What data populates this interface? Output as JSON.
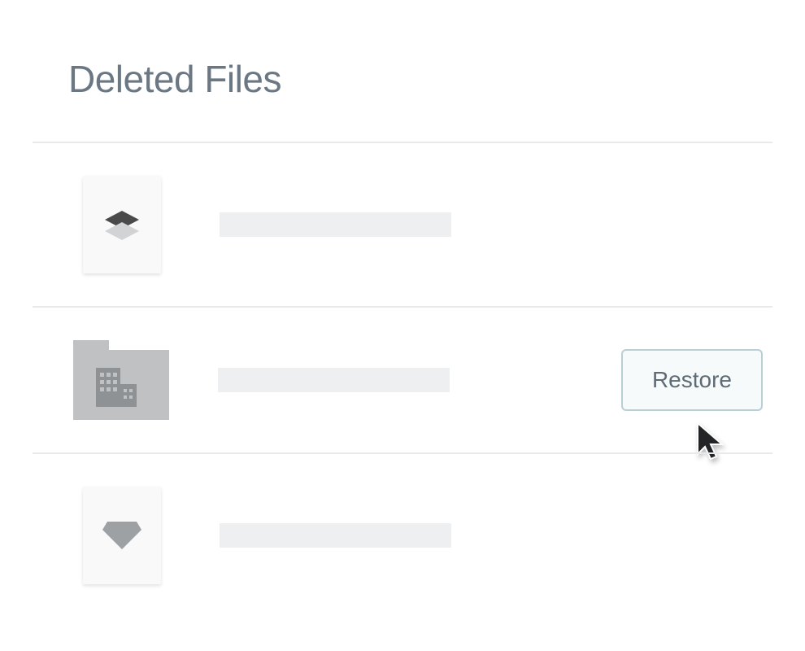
{
  "page": {
    "title": "Deleted Files"
  },
  "files": {
    "items": [
      {
        "icon": "layers",
        "type": "file"
      },
      {
        "icon": "building",
        "type": "folder",
        "action_label": "Restore",
        "show_cursor": true
      },
      {
        "icon": "diamond",
        "type": "file"
      }
    ]
  },
  "actions": {
    "restore_label": "Restore"
  }
}
